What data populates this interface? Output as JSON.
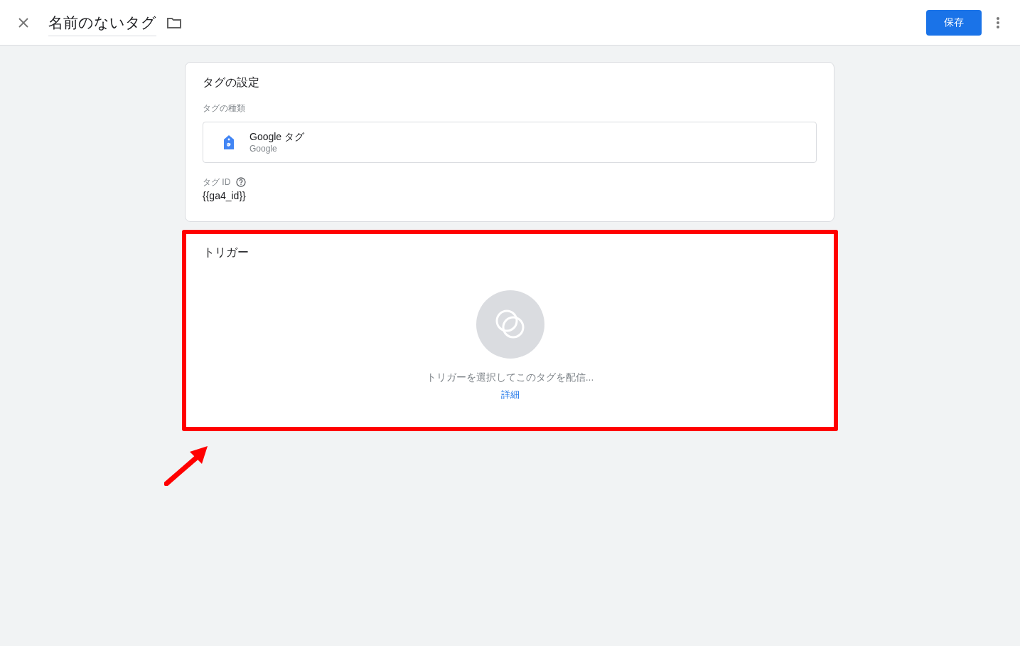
{
  "header": {
    "title": "名前のないタグ",
    "save_button": "保存"
  },
  "tag_config": {
    "title": "タグの設定",
    "type_label": "タグの種類",
    "tag_type": {
      "name": "Google タグ",
      "vendor": "Google"
    },
    "id_label": "タグ ID",
    "id_value": "{{ga4_id}}"
  },
  "trigger": {
    "title": "トリガー",
    "empty_text": "トリガーを選択してこのタグを配信...",
    "link": "詳細"
  }
}
